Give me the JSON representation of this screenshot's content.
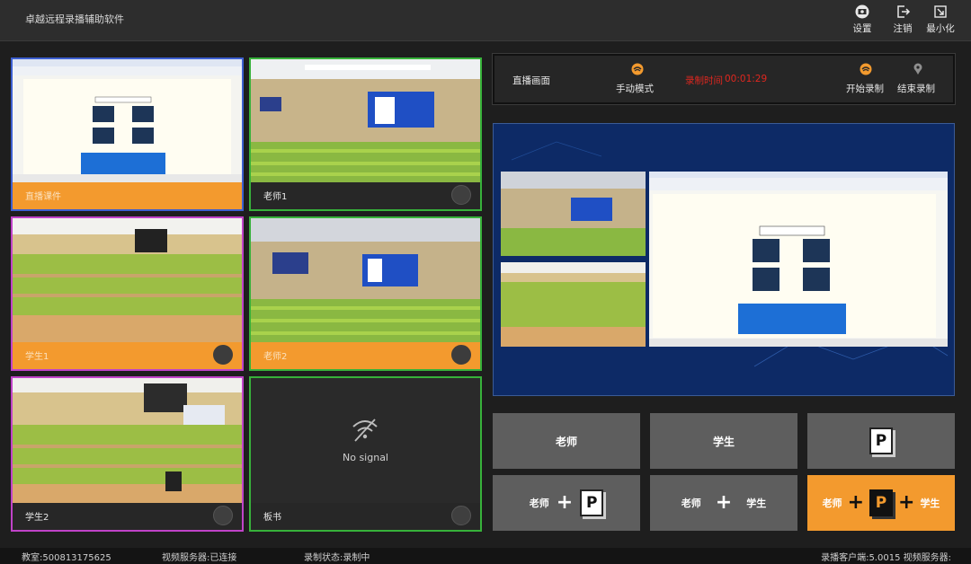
{
  "app": {
    "title": "卓越远程录播辅助软件"
  },
  "header": {
    "settings_label": "设置",
    "logout_label": "注销",
    "minimize_label": "最小化"
  },
  "tiles": {
    "courseware": {
      "label": "直播课件"
    },
    "teacher1": {
      "label": "老师1"
    },
    "student1": {
      "label": "学生1"
    },
    "teacher2": {
      "label": "老师2"
    },
    "student2": {
      "label": "学生2"
    },
    "blackboard": {
      "label": "板书",
      "no_signal": "No signal"
    }
  },
  "control": {
    "live_label": "直播画面",
    "mode_label": "手动模式",
    "rec_time_label": "录制时间",
    "rec_time_value": "00:01:29",
    "start_label": "开始录制",
    "stop_label": "结束录制"
  },
  "layouts": {
    "teacher": "老师",
    "student": "学生",
    "teacher_doc_a": "老师",
    "teacher_student_a": "老师",
    "teacher_student_b": "学生",
    "teacher_doc_student_a": "老师",
    "teacher_doc_student_b": "学生",
    "doc_glyph": "P"
  },
  "status": {
    "classroom": "教室:500813175625",
    "video_server": "视频服务器:已连接",
    "record_state": "录制状态:录制中",
    "client": "录播客户端:5.0015 视频服务器:"
  },
  "colors": {
    "accent": "#f39a2e",
    "rec_red": "#e0271f",
    "frame_blue": "#3d5fd0",
    "frame_green": "#37b23a",
    "frame_magenta": "#c043c8"
  }
}
